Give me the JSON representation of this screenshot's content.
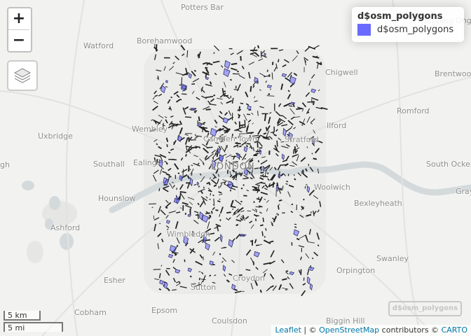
{
  "map": {
    "places": [
      {
        "name": "Potters Bar",
        "city": false
      },
      {
        "name": "Borehamwood",
        "city": false
      },
      {
        "name": "Watford",
        "city": false
      },
      {
        "name": "Chigwell",
        "city": false
      },
      {
        "name": "Brentwood",
        "city": false
      },
      {
        "name": "Chipping Ongar",
        "city": false
      },
      {
        "name": "Romford",
        "city": false
      },
      {
        "name": "Uxbridge",
        "city": false
      },
      {
        "name": "Wembley",
        "city": false
      },
      {
        "name": "Camden Town",
        "city": false
      },
      {
        "name": "Ilford",
        "city": false
      },
      {
        "name": "Stratford",
        "city": false
      },
      {
        "name": "Southall",
        "city": false
      },
      {
        "name": "Ealing",
        "city": false
      },
      {
        "name": "LONDON",
        "city": true
      },
      {
        "name": "South Ockendon",
        "city": false
      },
      {
        "name": "Woolwich",
        "city": false
      },
      {
        "name": "Hounslow",
        "city": false
      },
      {
        "name": "Bexleyheath",
        "city": false
      },
      {
        "name": "Ashford",
        "city": false
      },
      {
        "name": "Wimbledon",
        "city": false
      },
      {
        "name": "Swanley",
        "city": false
      },
      {
        "name": "Orpington",
        "city": false
      },
      {
        "name": "Esher",
        "city": false
      },
      {
        "name": "Sutton",
        "city": false
      },
      {
        "name": "Croydon",
        "city": false
      },
      {
        "name": "Cobham",
        "city": false
      },
      {
        "name": "Epsom",
        "city": false
      },
      {
        "name": "Coulsdon",
        "city": false
      },
      {
        "name": "Biggin Hill",
        "city": false
      },
      {
        "name": "Gray",
        "city": false
      },
      {
        "name": "gh",
        "city": false
      }
    ]
  },
  "controls": {
    "zoom_in": "+",
    "zoom_out": "−",
    "layers_icon": "layers-icon"
  },
  "legend": {
    "title": "d$osm_polygons",
    "items": [
      {
        "label": "d$osm_polygons",
        "color": "#6a6aff"
      }
    ]
  },
  "layer_toggle": {
    "label": "d$osm_polygons"
  },
  "scale": {
    "km": "5 km",
    "mi": "5 mi"
  },
  "attribution": {
    "leaflet": "Leaflet",
    "sep": " | © ",
    "osm": "OpenStreetMap",
    "mid": " contributors © ",
    "carto": "CARTO"
  },
  "colors": {
    "land": "#f2f2f0",
    "water": "#d4dadc",
    "polygon_fill": "#6a6aff",
    "polygon_stroke": "#222222"
  }
}
